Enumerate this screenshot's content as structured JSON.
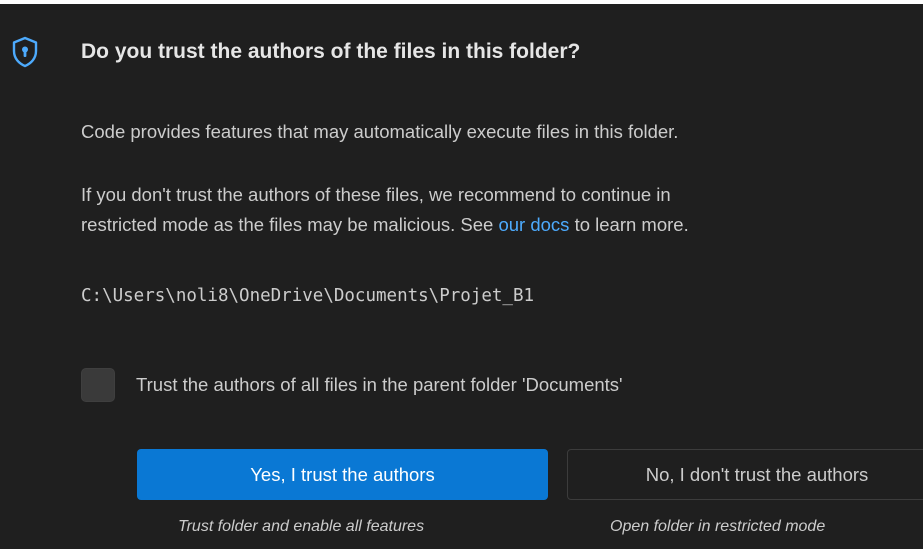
{
  "dialog": {
    "title": "Do you trust the authors of the files in this folder?",
    "icon": "shield-lock-icon",
    "accent_color": "#4daafc",
    "message_1": "Code provides features that may automatically execute files in this folder.",
    "message_2_line_1": "If you don't trust the authors of these files, we recommend to continue in",
    "message_2_line_2_before_link": "restricted mode as the files may be malicious. See ",
    "message_2_link": "our docs",
    "message_2_line_2_after_link": " to learn more.",
    "folder_path": "C:\\Users\\noli8\\OneDrive\\Documents\\Projet_B1",
    "checkbox": {
      "label": "Trust the authors of all files in the parent folder 'Documents'",
      "checked": false
    },
    "buttons": {
      "trust_label": "Yes, I trust the authors",
      "trust_caption": "Trust folder and enable all features",
      "trust_color": "#0a78d4",
      "distrust_label": "No, I don't trust the authors",
      "distrust_caption": "Open folder in restricted mode"
    }
  }
}
